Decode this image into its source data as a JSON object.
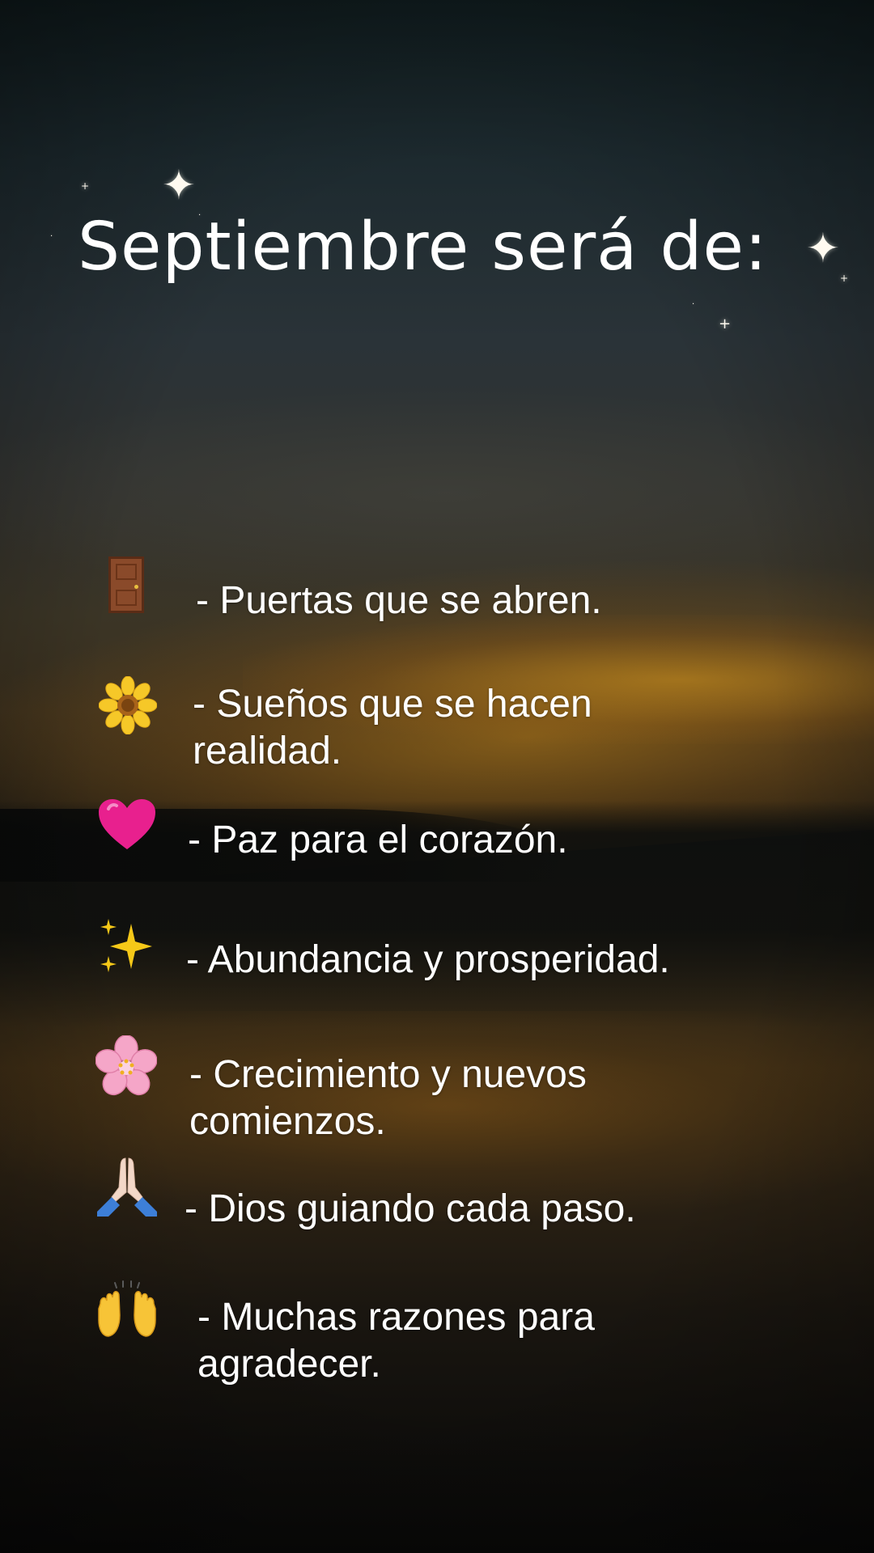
{
  "title": "Septiembre será de:",
  "items": [
    {
      "icon": "door-icon",
      "text": "- Puertas que se abren."
    },
    {
      "icon": "sunflower-icon",
      "text": "- Sueños que se hacen realidad."
    },
    {
      "icon": "pink-heart-icon",
      "text": "- Paz para el corazón."
    },
    {
      "icon": "sparkles-icon",
      "text": "- Abundancia y prosperidad."
    },
    {
      "icon": "cherry-blossom-icon",
      "text": "- Crecimiento y nuevos comienzos."
    },
    {
      "icon": "praying-hands-icon",
      "text": "- Dios guiando cada paso."
    },
    {
      "icon": "raising-hands-icon",
      "text": "- Muchas razones para agradecer."
    }
  ],
  "colors": {
    "text": "#ffffff",
    "sunset_glow": "#c48418",
    "sky_top": "#0f1a1c"
  }
}
